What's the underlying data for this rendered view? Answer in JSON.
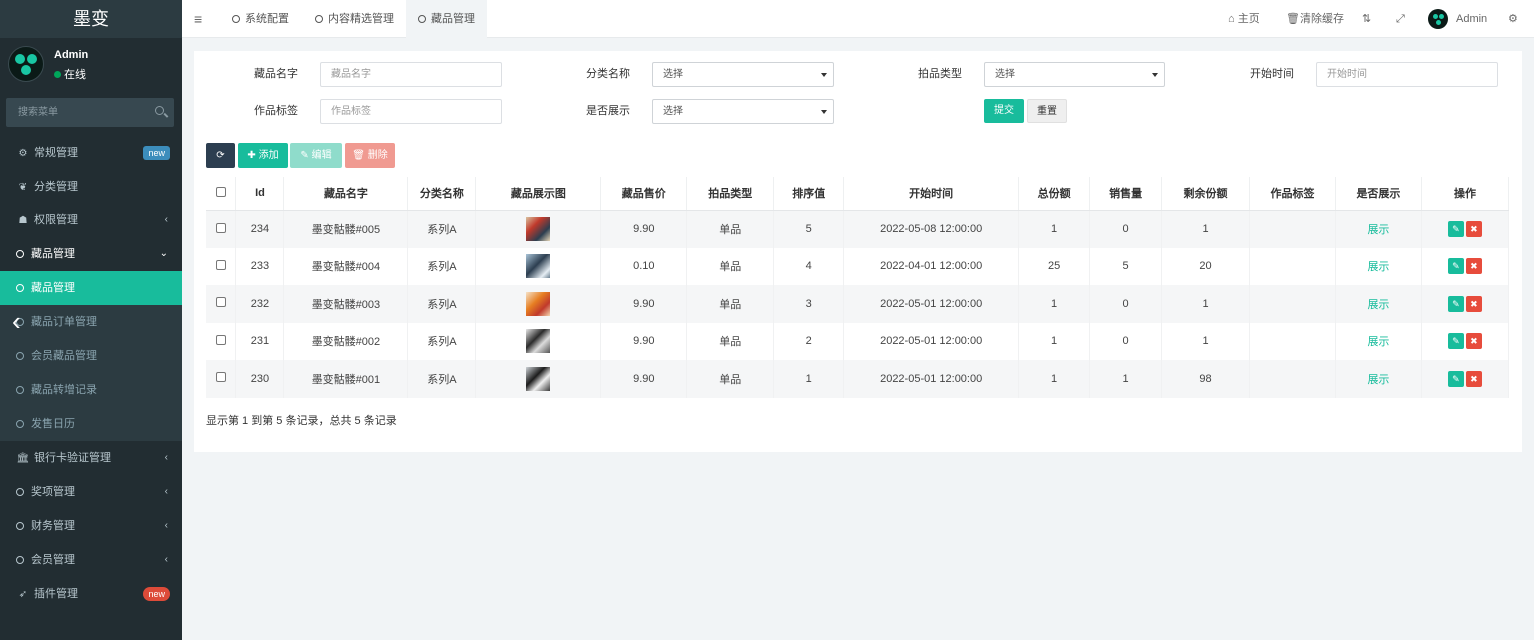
{
  "brand": "墨变",
  "user": {
    "name": "Admin",
    "status": "在线"
  },
  "sidebar": {
    "search_placeholder": "搜索菜单",
    "items": [
      {
        "label": "常规管理",
        "icon": "cogs-icon",
        "badge": "new"
      },
      {
        "label": "分类管理",
        "icon": "leaf-icon"
      },
      {
        "label": "权限管理",
        "icon": "users-icon"
      },
      {
        "label": "藏品管理",
        "icon": "circle-icon"
      },
      {
        "label": "藏品管理",
        "icon": "circle-icon"
      },
      {
        "label": "藏品订单管理",
        "icon": "circle-icon"
      },
      {
        "label": "会员藏品管理",
        "icon": "circle-icon"
      },
      {
        "label": "藏品转增记录",
        "icon": "circle-icon"
      },
      {
        "label": "发售日历",
        "icon": "circle-icon"
      },
      {
        "label": "银行卡验证管理",
        "icon": "bank-icon"
      },
      {
        "label": "奖项管理",
        "icon": "circle-icon"
      },
      {
        "label": "财务管理",
        "icon": "circle-icon"
      },
      {
        "label": "会员管理",
        "icon": "circle-icon"
      },
      {
        "label": "插件管理",
        "icon": "rocket-icon",
        "badge": "new"
      }
    ]
  },
  "tabs": [
    {
      "label": "系统配置"
    },
    {
      "label": "内容精选管理"
    },
    {
      "label": "藏品管理"
    }
  ],
  "topright": {
    "home": "主页",
    "clear_cache": "清除缓存",
    "admin": "Admin"
  },
  "filters": {
    "name_label": "藏品名字",
    "name_placeholder": "藏品名字",
    "category_label": "分类名称",
    "category_value": "选择",
    "type_label": "拍品类型",
    "type_value": "选择",
    "start_label": "开始时间",
    "start_placeholder": "开始时间",
    "tag_label": "作品标签",
    "tag_placeholder": "作品标签",
    "show_label": "是否展示",
    "show_value": "选择",
    "submit": "提交",
    "reset": "重置"
  },
  "toolbar": {
    "add": "添加",
    "edit": "编辑",
    "delete": "删除"
  },
  "table": {
    "headers": [
      "Id",
      "藏品名字",
      "分类名称",
      "藏品展示图",
      "藏品售价",
      "拍品类型",
      "排序值",
      "开始时间",
      "总份额",
      "销售量",
      "剩余份额",
      "作品标签",
      "是否展示",
      "操作"
    ],
    "rows": [
      {
        "id": "234",
        "name": "墨变骷髅#005",
        "category": "系列A",
        "price": "9.90",
        "type": "单品",
        "sort": "5",
        "start": "2022-05-08 12:00:00",
        "total": "1",
        "sold": "0",
        "remain": "1",
        "tag": "",
        "show": "展示"
      },
      {
        "id": "233",
        "name": "墨变骷髅#004",
        "category": "系列A",
        "price": "0.10",
        "type": "单品",
        "sort": "4",
        "start": "2022-04-01 12:00:00",
        "total": "25",
        "sold": "5",
        "remain": "20",
        "tag": "",
        "show": "展示"
      },
      {
        "id": "232",
        "name": "墨变骷髅#003",
        "category": "系列A",
        "price": "9.90",
        "type": "单品",
        "sort": "3",
        "start": "2022-05-01 12:00:00",
        "total": "1",
        "sold": "0",
        "remain": "1",
        "tag": "",
        "show": "展示"
      },
      {
        "id": "231",
        "name": "墨变骷髅#002",
        "category": "系列A",
        "price": "9.90",
        "type": "单品",
        "sort": "2",
        "start": "2022-05-01 12:00:00",
        "total": "1",
        "sold": "0",
        "remain": "1",
        "tag": "",
        "show": "展示"
      },
      {
        "id": "230",
        "name": "墨变骷髅#001",
        "category": "系列A",
        "price": "9.90",
        "type": "单品",
        "sort": "1",
        "start": "2022-05-01 12:00:00",
        "total": "1",
        "sold": "1",
        "remain": "98",
        "tag": "",
        "show": "展示"
      }
    ]
  },
  "footer": "显示第 1 到第 5 条记录，总共 5 条记录",
  "colors": {
    "accent": "#18bc9c",
    "sidebar_bg": "#222d32",
    "danger": "#e74c3c",
    "primary_dark": "#2c3e50"
  }
}
